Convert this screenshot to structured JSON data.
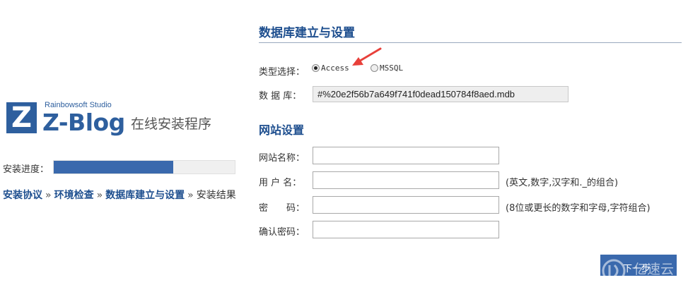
{
  "logo": {
    "mark": "Z",
    "studio": "Rainbowsoft Studio",
    "name": "Z-Blog",
    "subtitle": "在线安装程序"
  },
  "progress": {
    "label": "安装进度：",
    "percent": 66
  },
  "steps": [
    {
      "label": "安装协议",
      "state": "done"
    },
    {
      "label": "环境检查",
      "state": "done"
    },
    {
      "label": "数据库建立与设置",
      "state": "done"
    },
    {
      "label": "安装结果",
      "state": "pending"
    }
  ],
  "step_separator": "»",
  "database_section": {
    "title": "数据库建立与设置",
    "type_label": "类型选择：",
    "options": [
      {
        "label": "Access",
        "selected": true
      },
      {
        "label": "MSSQL",
        "selected": false
      }
    ],
    "db_label": "数 据 库：",
    "db_value": "#%20e2f56b7a649f741f0dead150784f8aed.mdb"
  },
  "site_section": {
    "title": "网站设置",
    "fields": [
      {
        "label": "网站名称：",
        "value": "",
        "hint": ""
      },
      {
        "label": "用 户 名：",
        "value": "",
        "hint": "(英文,数字,汉字和._的组合)"
      },
      {
        "label": "密　　码：",
        "value": "",
        "hint": "(8位或更长的数字和字母,字符组合)"
      },
      {
        "label": "确认密码：",
        "value": "",
        "hint": ""
      }
    ]
  },
  "next_button": {
    "label": "下一步"
  },
  "watermark": {
    "text": "亿速云"
  },
  "colors": {
    "brand_blue": "#2e5f9e",
    "link_blue": "#1e4f8f",
    "progress_fill": "#3a69ad",
    "annotation_arrow": "#e8403a"
  },
  "icons": {
    "annotation": "red-arrow-icon",
    "watermark": "cloud-logo-icon"
  }
}
